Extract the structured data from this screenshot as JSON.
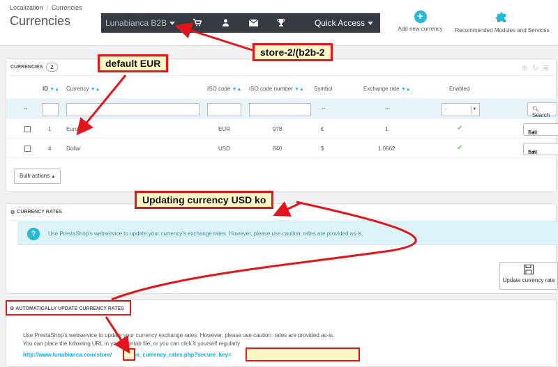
{
  "breadcrumb": [
    "Localization",
    "Currencies"
  ],
  "page_title": "Currencies",
  "topbar": {
    "shop": "Lunabianca B2B",
    "quick_access": "Quick Access"
  },
  "toolbar": {
    "add_new": "Add new currency",
    "recommended": "Recommended Modules and Services"
  },
  "currencies_panel": {
    "title": "CURRENCIES",
    "count": "2",
    "columns": [
      "ID",
      "Currency",
      "ISO code",
      "ISO code number",
      "Symbol",
      "Exchange rate",
      "Enabled"
    ],
    "filter_placeholder_dash": "--",
    "enabled_filter": "-",
    "search_label": "Search",
    "rows": [
      {
        "id": "1",
        "currency": "Euro",
        "iso": "EUR",
        "iso_num": "978",
        "symbol": "€",
        "rate": "1",
        "edit": "Edit"
      },
      {
        "id": "4",
        "currency": "Dollar",
        "iso": "USD",
        "iso_num": "840",
        "symbol": "$",
        "rate": "1.0662",
        "edit": "Edit"
      }
    ],
    "bulk_actions": "Bulk actions"
  },
  "rates_panel": {
    "title": "CURRENCY RATES",
    "alert": "Use PrestaShop's webservice to update your currency's exchange rates. However, please use caution: rates are provided as-is.",
    "update_button": "Update currency rate"
  },
  "auto_panel": {
    "title": "AUTOMATICALLY UPDATE CURRENCY RATES",
    "line1": "Use PrestaShop's webservice to update your currency exchange rates. However, please use caution: rates are provided as-is.",
    "line2": "You can place the following URL in your crontab file, or you can click it yourself regularly",
    "link_start": "http://www.lunabianca.com/store/",
    "link_end": "/cron_currency_rates.php?secure_key="
  },
  "annotations": {
    "default_eur": "default EUR",
    "store": "store-2/(b2b-2",
    "updating": "Updating currency USD ko"
  },
  "colors": {
    "accent": "#25b9d7",
    "annotation_red": "#e3141a",
    "annotation_fill": "#fff7c6",
    "topbar": "#363a41"
  }
}
